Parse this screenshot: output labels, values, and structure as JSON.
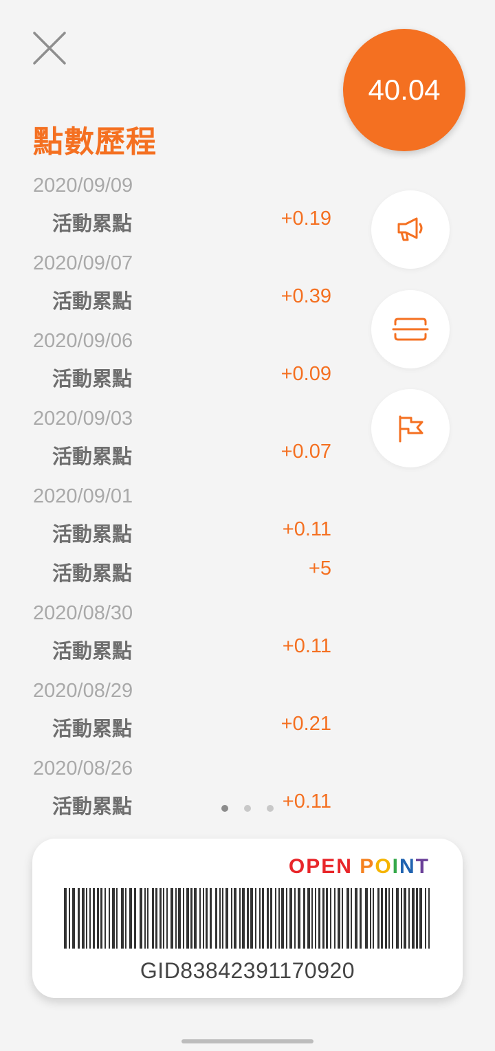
{
  "header": {
    "balance": "40.04",
    "title": "點數歷程"
  },
  "history": [
    {
      "date": "2020/09/09",
      "entries": [
        {
          "label": "活動累點",
          "amount": "+0.19"
        }
      ]
    },
    {
      "date": "2020/09/07",
      "entries": [
        {
          "label": "活動累點",
          "amount": "+0.39"
        }
      ]
    },
    {
      "date": "2020/09/06",
      "entries": [
        {
          "label": "活動累點",
          "amount": "+0.09"
        }
      ]
    },
    {
      "date": "2020/09/03",
      "entries": [
        {
          "label": "活動累點",
          "amount": "+0.07"
        }
      ]
    },
    {
      "date": "2020/09/01",
      "entries": [
        {
          "label": "活動累點",
          "amount": "+0.11"
        },
        {
          "label": "活動累點",
          "amount": "+5"
        }
      ]
    },
    {
      "date": "2020/08/30",
      "entries": [
        {
          "label": "活動累點",
          "amount": "+0.11"
        }
      ]
    },
    {
      "date": "2020/08/29",
      "entries": [
        {
          "label": "活動累點",
          "amount": "+0.21"
        }
      ]
    },
    {
      "date": "2020/08/26",
      "entries": [
        {
          "label": "活動累點",
          "amount": "+0.11"
        }
      ]
    }
  ],
  "side_buttons": [
    "megaphone-icon",
    "scan-icon",
    "flag-icon"
  ],
  "pager": {
    "count": 3,
    "active": 1
  },
  "card": {
    "brand": "OPEN POINT",
    "barcode_text": "GID83842391170920"
  },
  "colors": {
    "accent": "#f47021",
    "background": "#f4f4f4",
    "date_text": "#a9a9a9",
    "label_text": "#6e6e6e"
  }
}
